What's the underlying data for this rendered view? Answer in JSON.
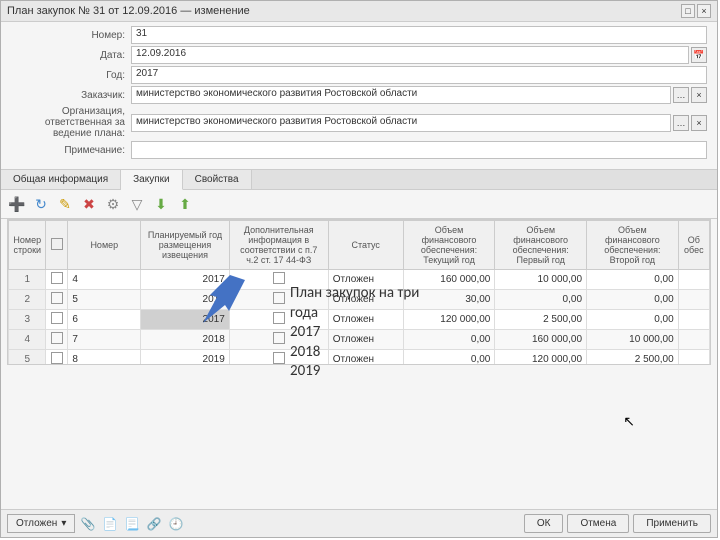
{
  "window": {
    "title": "План закупок № 31 от 12.09.2016 — изменение"
  },
  "form": {
    "number_label": "Номер:",
    "number_value": "31",
    "date_label": "Дата:",
    "date_value": "12.09.2016",
    "year_label": "Год:",
    "year_value": "2017",
    "customer_label": "Заказчик:",
    "customer_value": "министерство экономического развития Ростовской области",
    "org_label": "Организация, ответственная за ведение плана:",
    "org_value": "министерство экономического развития Ростовской области",
    "note_label": "Примечание:",
    "note_value": ""
  },
  "tabs": {
    "general": "Общая информация",
    "purchases": "Закупки",
    "props": "Свойства"
  },
  "grid": {
    "headers": {
      "rownum": "Номер строки",
      "number": "Номер",
      "planned_year": "Планируемый год размещения извещения",
      "extra_info": "Дополнительная информация в соответствии с п.7 ч.2 ст. 17 44-ФЗ",
      "status": "Статус",
      "fin_current": "Объем финансового обеспечения: Текущий год",
      "fin_first": "Объем финансового обеспечения: Первый год",
      "fin_second": "Объем финансового обеспечения: Второй год",
      "fin_ob": "Об обес"
    },
    "rows": [
      {
        "n": "1",
        "num": "4",
        "year": "2017",
        "status": "Отложен",
        "c": "160 000,00",
        "f": "10 000,00",
        "s": "0,00"
      },
      {
        "n": "2",
        "num": "5",
        "year": "2017",
        "status": "Отложен",
        "c": "30,00",
        "f": "0,00",
        "s": "0,00"
      },
      {
        "n": "3",
        "num": "6",
        "year": "2017",
        "status": "Отложен",
        "c": "120 000,00",
        "f": "2 500,00",
        "s": "0,00"
      },
      {
        "n": "4",
        "num": "7",
        "year": "2018",
        "status": "Отложен",
        "c": "0,00",
        "f": "160 000,00",
        "s": "10 000,00"
      },
      {
        "n": "5",
        "num": "8",
        "year": "2019",
        "status": "Отложен",
        "c": "0,00",
        "f": "120 000,00",
        "s": "2 500,00"
      }
    ]
  },
  "footer": {
    "postpone": "Отложен",
    "ok": "ОК",
    "cancel": "Отмена",
    "apply": "Применить"
  },
  "annotation": {
    "line1": "План закупок на три года",
    "y1": "2017",
    "y2": "2018",
    "y3": "2019"
  }
}
